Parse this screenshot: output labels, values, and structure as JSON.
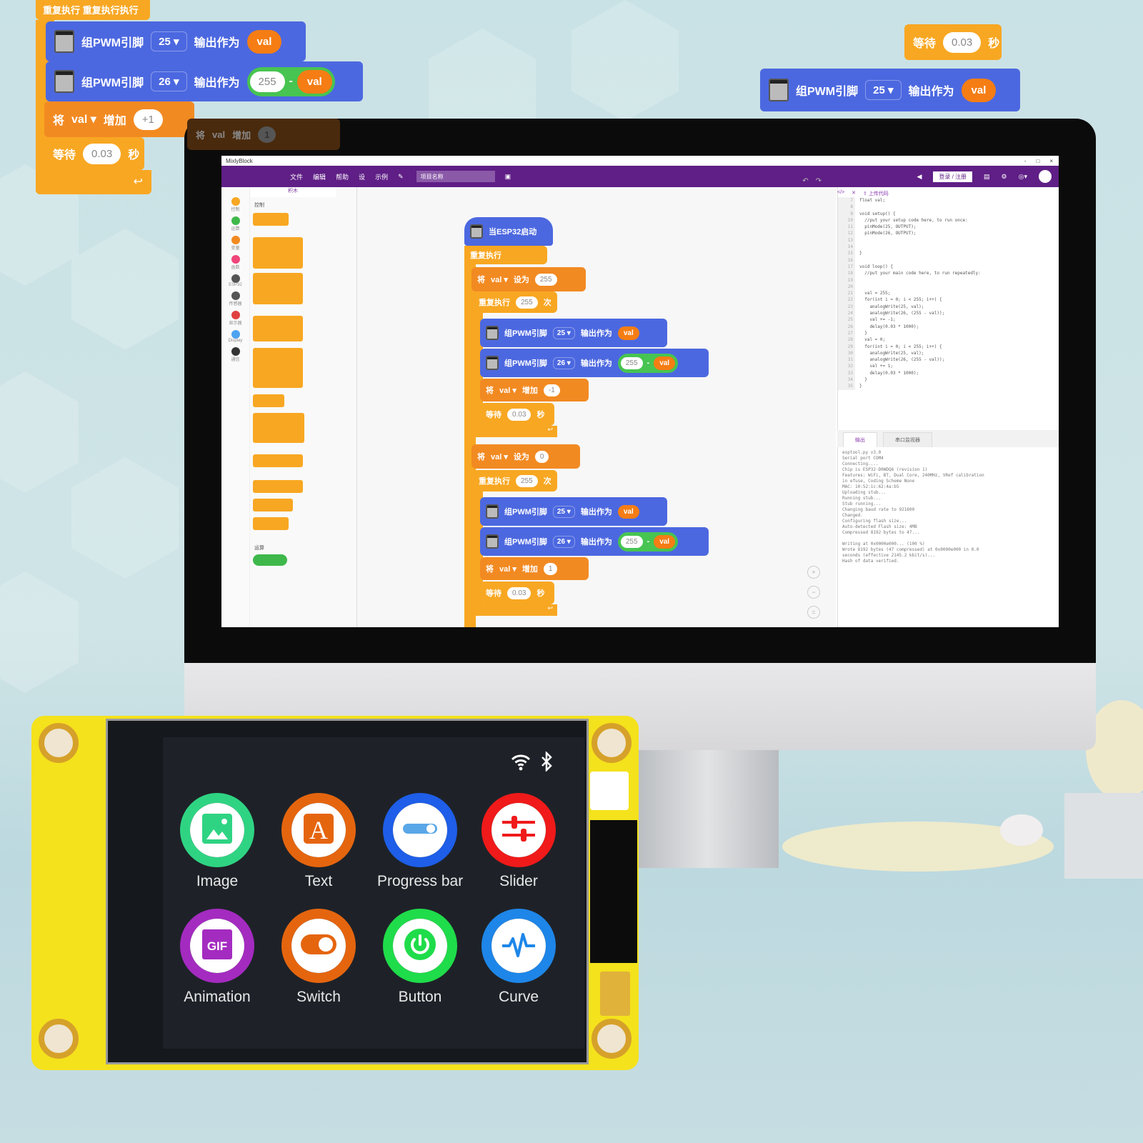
{
  "top_left_stack": {
    "header_label": "重复执行 重复执行执行",
    "pwm_block_1": {
      "label": "组PWM引脚",
      "pin": "25",
      "output_label": "输出作为",
      "value": "val"
    },
    "pwm_block_2": {
      "label": "组PWM引脚",
      "pin": "26",
      "output_label": "输出作为",
      "left_operand": "255",
      "operator": "-",
      "right_operand": "val"
    },
    "change_block": {
      "prefix": "将",
      "variable": "val",
      "action": "增加",
      "amount": "+1"
    },
    "ghost_change_block": {
      "prefix": "将",
      "variable": "val",
      "action": "增加",
      "amount": "1"
    },
    "wait_block": {
      "prefix": "等待",
      "value": "0.03",
      "suffix": "秒"
    }
  },
  "top_right_stack": {
    "wait_block": {
      "prefix": "等待",
      "value": "0.03",
      "suffix": "秒"
    },
    "pwm_block": {
      "label": "组PWM引脚",
      "pin": "25",
      "output_label": "输出作为",
      "value": "val"
    }
  },
  "ide": {
    "window_title": "MixlyBlock",
    "window_controls": [
      "-",
      "□",
      "×"
    ],
    "menu": [
      "文件",
      "编辑",
      "帮助",
      "设",
      "示例"
    ],
    "project_name": "项目名称",
    "login_label": "登录 / 注册",
    "palette_tab": "积木",
    "palette_heading": "控制",
    "palette_footer_heading": "运算",
    "categories": [
      {
        "label": "控制",
        "color": "#f8a722"
      },
      {
        "label": "运算",
        "color": "#3fb84b"
      },
      {
        "label": "变量",
        "color": "#f28a22"
      },
      {
        "label": "函数",
        "color": "#f0457a"
      },
      {
        "label": "ESP32",
        "color": "#555555"
      },
      {
        "label": "传感器",
        "color": "#555555"
      },
      {
        "label": "显示器",
        "color": "#e04040"
      },
      {
        "label": "Display",
        "color": "#4da3f0"
      },
      {
        "label": "通信",
        "color": "#333333"
      }
    ],
    "editor_tools": {
      "undo": "↶",
      "redo": "↷",
      "upload_label": "上传代码"
    },
    "workspace": {
      "hat_label": "当ESP32启动",
      "forever_label": "重复执行",
      "set1": {
        "prefix": "将",
        "variable": "val",
        "action": "设为",
        "value": "255"
      },
      "repeat1": {
        "prefix": "重复执行",
        "count": "255",
        "suffix": "次"
      },
      "loop1": [
        {
          "label": "组PWM引脚",
          "pin": "25",
          "output_label": "输出作为",
          "value": "val"
        },
        {
          "label": "组PWM引脚",
          "pin": "26",
          "output_label": "输出作为",
          "left_operand": "255",
          "operator": "-",
          "right_operand": "val"
        }
      ],
      "change1": {
        "prefix": "将",
        "variable": "val",
        "action": "增加",
        "amount": "-1"
      },
      "wait1": {
        "prefix": "等待",
        "value": "0.03",
        "suffix": "秒"
      },
      "set2": {
        "prefix": "将",
        "variable": "val",
        "action": "设为",
        "value": "0"
      },
      "repeat2": {
        "prefix": "重复执行",
        "count": "255",
        "suffix": "次"
      },
      "loop2": [
        {
          "label": "组PWM引脚",
          "pin": "25",
          "output_label": "输出作为",
          "value": "val"
        },
        {
          "label": "组PWM引脚",
          "pin": "26",
          "output_label": "输出作为",
          "left_operand": "255",
          "operator": "-",
          "right_operand": "val"
        }
      ],
      "change2": {
        "prefix": "将",
        "variable": "val",
        "action": "增加",
        "amount": "1"
      },
      "wait2": {
        "prefix": "等待",
        "value": "0.03",
        "suffix": "秒"
      },
      "zoom_controls": [
        "+",
        "−",
        "="
      ]
    },
    "code_lines": [
      {
        "n": "7",
        "t": "float val;"
      },
      {
        "n": "8",
        "t": ""
      },
      {
        "n": "9",
        "t": "void setup() {"
      },
      {
        "n": "10",
        "t": "  //put your setup code here, to run once:"
      },
      {
        "n": "11",
        "t": "  pinMode(25, OUTPUT);"
      },
      {
        "n": "12",
        "t": "  pinMode(26, OUTPUT);"
      },
      {
        "n": "13",
        "t": ""
      },
      {
        "n": "14",
        "t": ""
      },
      {
        "n": "15",
        "t": "}"
      },
      {
        "n": "16",
        "t": ""
      },
      {
        "n": "17",
        "t": "void loop() {"
      },
      {
        "n": "18",
        "t": "  //put your main code here, to run repeatedly:"
      },
      {
        "n": "19",
        "t": ""
      },
      {
        "n": "20",
        "t": ""
      },
      {
        "n": "21",
        "t": "  val = 255;"
      },
      {
        "n": "22",
        "t": "  for(int i = 0; i < 255; i++) {"
      },
      {
        "n": "23",
        "t": "    analogWrite(25, val);"
      },
      {
        "n": "24",
        "t": "    analogWrite(26, (255 - val));"
      },
      {
        "n": "25",
        "t": "    val += -1;"
      },
      {
        "n": "26",
        "t": "    delay(0.03 * 1000);"
      },
      {
        "n": "27",
        "t": "  }"
      },
      {
        "n": "28",
        "t": "  val = 0;"
      },
      {
        "n": "29",
        "t": "  for(int i = 0; i < 255; i++) {"
      },
      {
        "n": "30",
        "t": "    analogWrite(25, val);"
      },
      {
        "n": "31",
        "t": "    analogWrite(26, (255 - val));"
      },
      {
        "n": "32",
        "t": "    val += 1;"
      },
      {
        "n": "33",
        "t": "    delay(0.03 * 1000);"
      },
      {
        "n": "34",
        "t": "  }"
      },
      {
        "n": "35",
        "t": "}"
      }
    ],
    "console_tabs": [
      "输出",
      "串口监视器"
    ],
    "console_text": "esptool.py v3.0\nSerial port COM4\nConnecting....\nChip is ESP32-D0WDQ6 (revision 1)\nFeatures: WiFi, BT, Dual Core, 240MHz, VRef calibration\nin efuse, Coding Scheme None\nMAC: 10:52:1c:62:4a:b5\nUploading stub...\nRunning stub...\nStub running...\nChanging baud rate to 921600\nChanged.\nConfiguring flash size...\nAuto-detected Flash size: 4MB\nCompressed 8192 bytes to 47...\n\nWriting at 0x0000e000... (100 %)\nWrote 8192 bytes (47 compressed) at 0x0000e000 in 0.0\nseconds (effective 2145.2 kbit/s)...\nHash of data verified."
  },
  "device": {
    "status_icons": {
      "wifi": "wifi-icon",
      "bluetooth": "bluetooth-icon"
    },
    "apps": [
      {
        "label": "Image",
        "icon": "image-icon",
        "color": "#2fd483"
      },
      {
        "label": "Text",
        "icon": "text-icon",
        "color": "#e5650f"
      },
      {
        "label": "Progress bar",
        "icon": "progress-bar-icon",
        "color": "#1e5ee8"
      },
      {
        "label": "Slider",
        "icon": "slider-icon",
        "color": "#f01a1a"
      },
      {
        "label": "Animation",
        "icon": "gif-icon",
        "color": "#a42bc0"
      },
      {
        "label": "Switch",
        "icon": "switch-icon",
        "color": "#e5650f"
      },
      {
        "label": "Button",
        "icon": "power-icon",
        "color": "#1fdc4a"
      },
      {
        "label": "Curve",
        "icon": "curve-icon",
        "color": "#1e86e8"
      }
    ],
    "text_glyph": "A",
    "gif_glyph": "GIF"
  }
}
